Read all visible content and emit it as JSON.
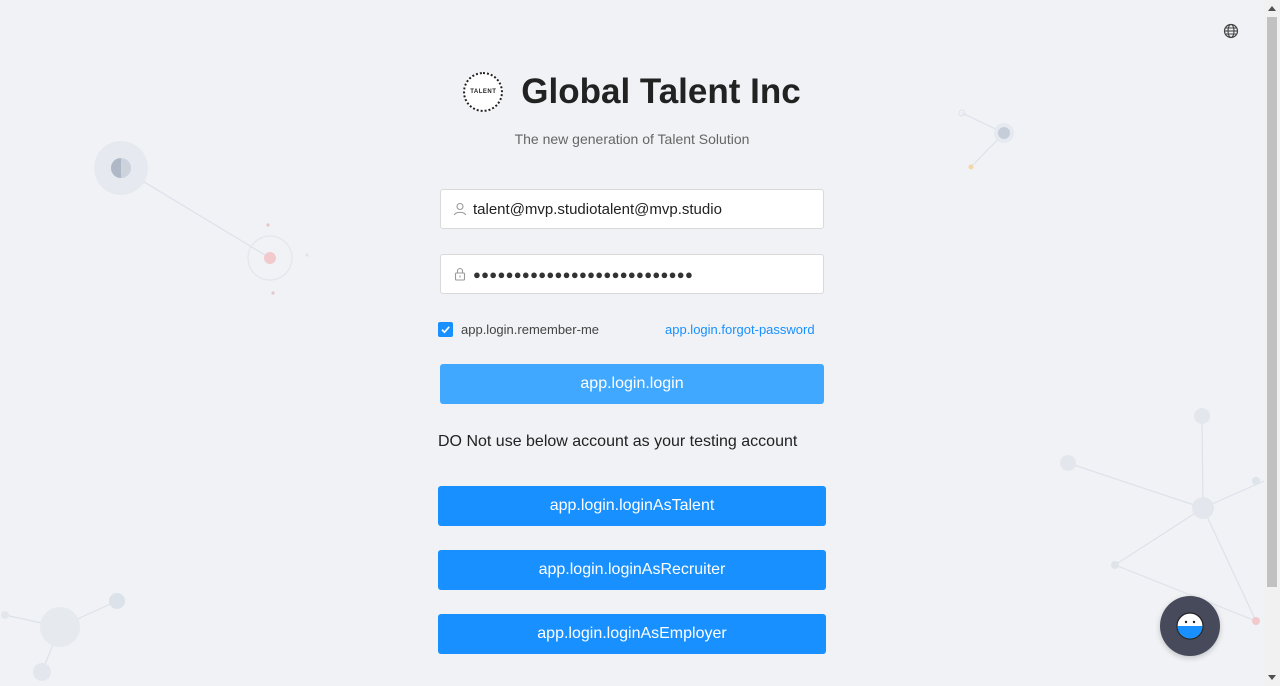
{
  "header": {
    "logo_text": "TALENT",
    "title": "Global Talent Inc",
    "subtitle": "The new generation of Talent Solution"
  },
  "login_form": {
    "username_value": "talent@mvp.studiotalent@mvp.studio",
    "password_masked": "●●●●●●●●●●●●●●●●●●●●●●●●●●●",
    "remember_me_label": "app.login.remember-me",
    "remember_me_checked": true,
    "forgot_password_label": "app.login.forgot-password",
    "login_button_label": "app.login.login"
  },
  "notice_text": "DO Not use below account as your testing account",
  "role_buttons": {
    "talent": "app.login.loginAsTalent",
    "recruiter": "app.login.loginAsRecruiter",
    "employer": "app.login.loginAsEmployer"
  },
  "icons": {
    "language": "globe-icon",
    "username": "user-icon",
    "password": "lock-icon",
    "chat": "chat-avatar-icon"
  },
  "colors": {
    "primary": "#1890ff",
    "login_button": "#40a9ff",
    "background": "#f0f2f5",
    "chat_fab": "#474a5a"
  }
}
